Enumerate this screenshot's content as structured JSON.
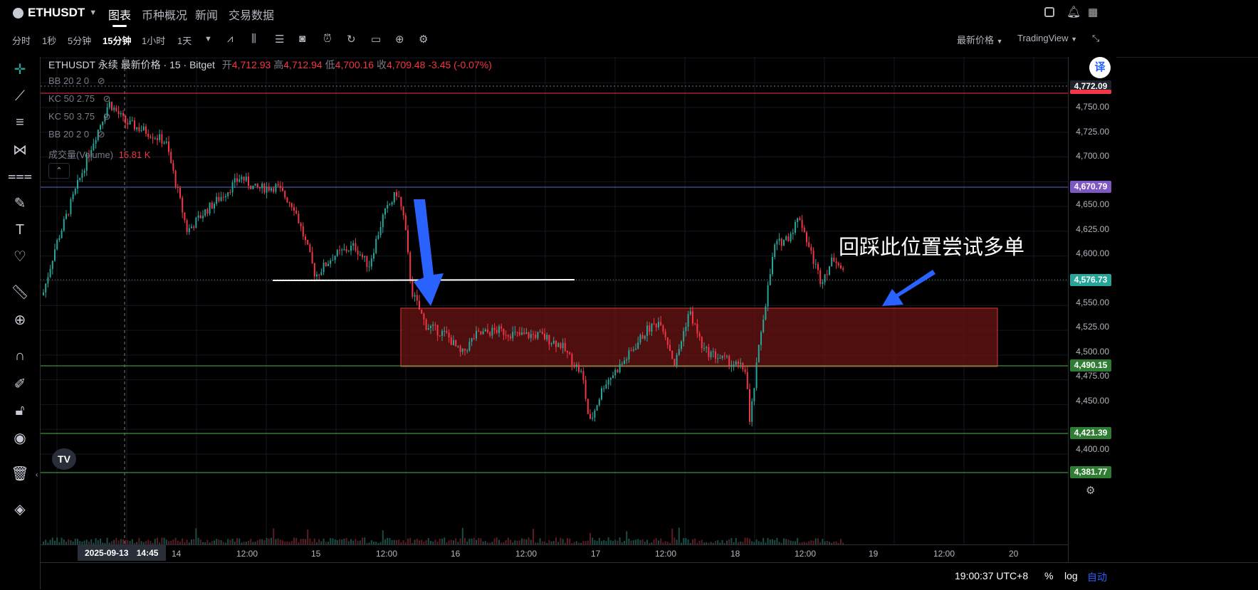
{
  "header": {
    "symbol": "ETHUSDT",
    "tabs": [
      "图表",
      "币种概况",
      "新闻",
      "交易数据"
    ]
  },
  "toolbar": {
    "timeframes": [
      "分时",
      "1秒",
      "5分钟",
      "15分钟",
      "1小时",
      "1天"
    ],
    "active_timeframe": "15分钟",
    "price_type": "最新价格",
    "platform": "TradingView"
  },
  "legend": {
    "title": "ETHUSDT 永续 最新价格 · 15 · Bitget",
    "open_label": "开",
    "open": "4,712.93",
    "high_label": "高",
    "high": "4,712.94",
    "low_label": "低",
    "low": "4,700.16",
    "close_label": "收",
    "close": "4,709.48",
    "change": "-3.45 (-0.07%)",
    "indicators": [
      "BB 20 2 0",
      "KC 50 2.75",
      "KC 50 3.75",
      "BB 20 2 0"
    ],
    "volume_label": "成交量(Volume)",
    "volume_value": "15.81 K"
  },
  "price_scale": {
    "labels": [
      "4,750.00",
      "4,725.00",
      "4,700.00",
      "4,650.00",
      "4,625.00",
      "4,600.00",
      "4,550.00",
      "4,525.00",
      "4,500.00",
      "4,475.00",
      "4,450.00",
      "4,400.00"
    ],
    "tags": [
      {
        "value": "4,772.09",
        "color": "#1e222d"
      },
      {
        "value": "4,670.79",
        "color": "#7e57c2"
      },
      {
        "value": "4,576.73",
        "color": "#26a69a"
      },
      {
        "value": "4,490.15",
        "color": "#2e7d32"
      },
      {
        "value": "4,421.39",
        "color": "#2e7d32"
      },
      {
        "value": "4,381.77",
        "color": "#2e7d32"
      }
    ]
  },
  "time_scale": {
    "labels": [
      "14",
      "12:00",
      "15",
      "12:00",
      "16",
      "12:00",
      "17",
      "12:00",
      "18",
      "12:00",
      "19",
      "12:00",
      "20"
    ],
    "crosshair_date": "2025-09-13",
    "crosshair_time": "14:45"
  },
  "annotation": {
    "text": "回踩此位置尝试多单"
  },
  "bottom": {
    "clock": "19:00:37 UTC+8",
    "percent": "%",
    "log": "log",
    "auto": "自动"
  },
  "translate_badge": "译",
  "colors": {
    "up": "#26a69a",
    "down": "#f23645",
    "zone": "#7a1a1a",
    "arrow": "#2962ff"
  },
  "left_tools": [
    "crosshair-icon",
    "trendline-icon",
    "fib-icon",
    "pattern-icon",
    "forecast-icon",
    "brush-icon",
    "text-icon",
    "heart-icon",
    "ruler-icon",
    "zoom-icon",
    "magnet-icon",
    "lock-draw-icon",
    "lock-icon",
    "eye-icon",
    "trash-icon",
    "layers-icon"
  ]
}
